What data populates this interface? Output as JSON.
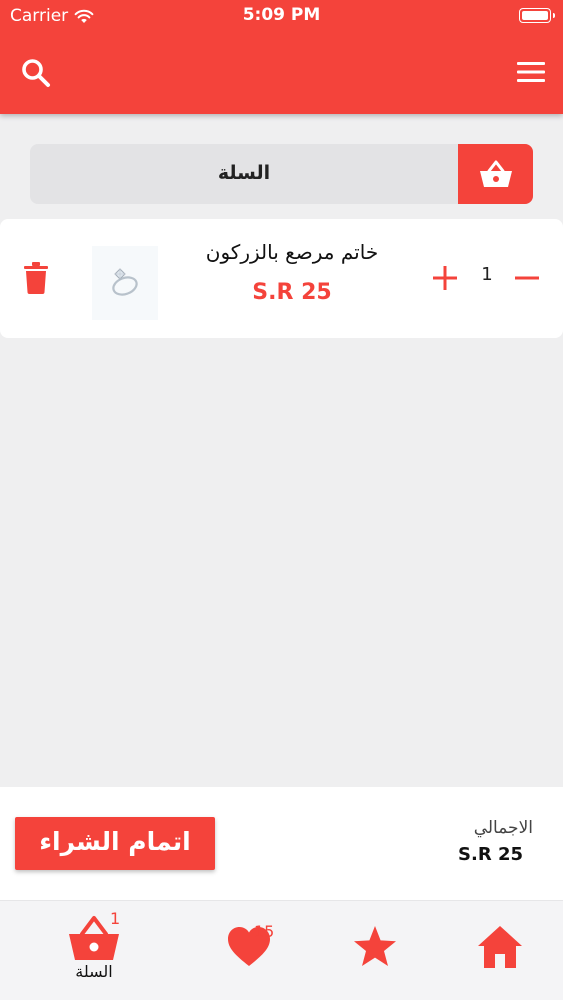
{
  "status_bar": {
    "carrier": "Carrier",
    "time": "5:09 PM"
  },
  "header": {
    "search_icon": "search-icon",
    "menu_icon": "hamburger-menu-icon"
  },
  "cart_bar": {
    "title": "السلة",
    "icon": "shopping-basket-icon"
  },
  "cart_items": [
    {
      "name": "خاتم مرصع بالزركون",
      "price": "S.R 25",
      "quantity": "1"
    }
  ],
  "summary": {
    "total_label": "الاجمالي",
    "total_value": "S.R 25",
    "checkout_label": "اتمام الشراء"
  },
  "tab_bar": {
    "cart": {
      "label": "السلة",
      "badge": "1",
      "icon": "shopping-basket-icon"
    },
    "favorites": {
      "badge": "15",
      "icon": "heart-icon"
    },
    "featured": {
      "icon": "star-icon"
    },
    "home": {
      "icon": "home-icon"
    }
  },
  "colors": {
    "accent": "#f4433b",
    "background": "#efeff0",
    "card": "#ffffff"
  }
}
